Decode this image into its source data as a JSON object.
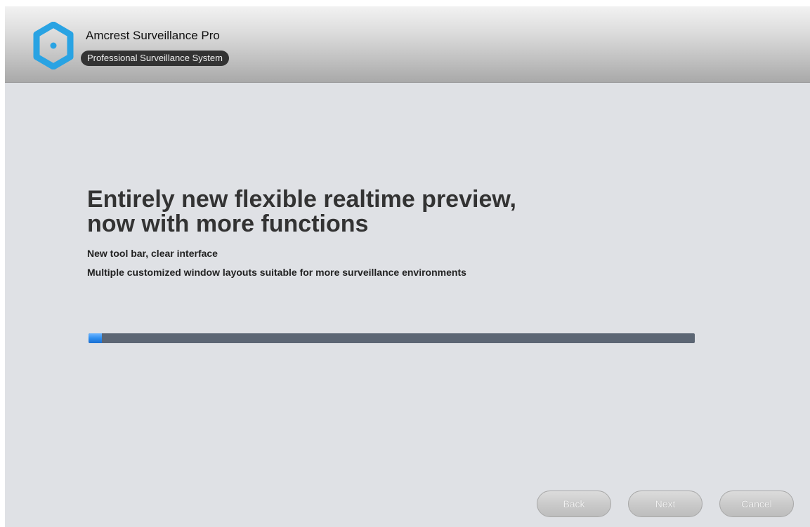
{
  "header": {
    "app_title": "Amcrest Surveillance Pro",
    "app_subtitle": "Professional Surveillance System",
    "logo_icon": "hexagon-logo-icon",
    "logo_color": "#29a3e3"
  },
  "main": {
    "headline_line1": "Entirely new flexible realtime preview,",
    "headline_line2": "now with more functions",
    "features": [
      "New tool bar, clear interface",
      "Multiple customized window layouts suitable for more surveillance environments"
    ],
    "progress_fraction": 0.022,
    "progress_color": "#2d8ef0"
  },
  "footer": {
    "back_label": "Back",
    "next_label": "Next",
    "cancel_label": "Cancel"
  }
}
